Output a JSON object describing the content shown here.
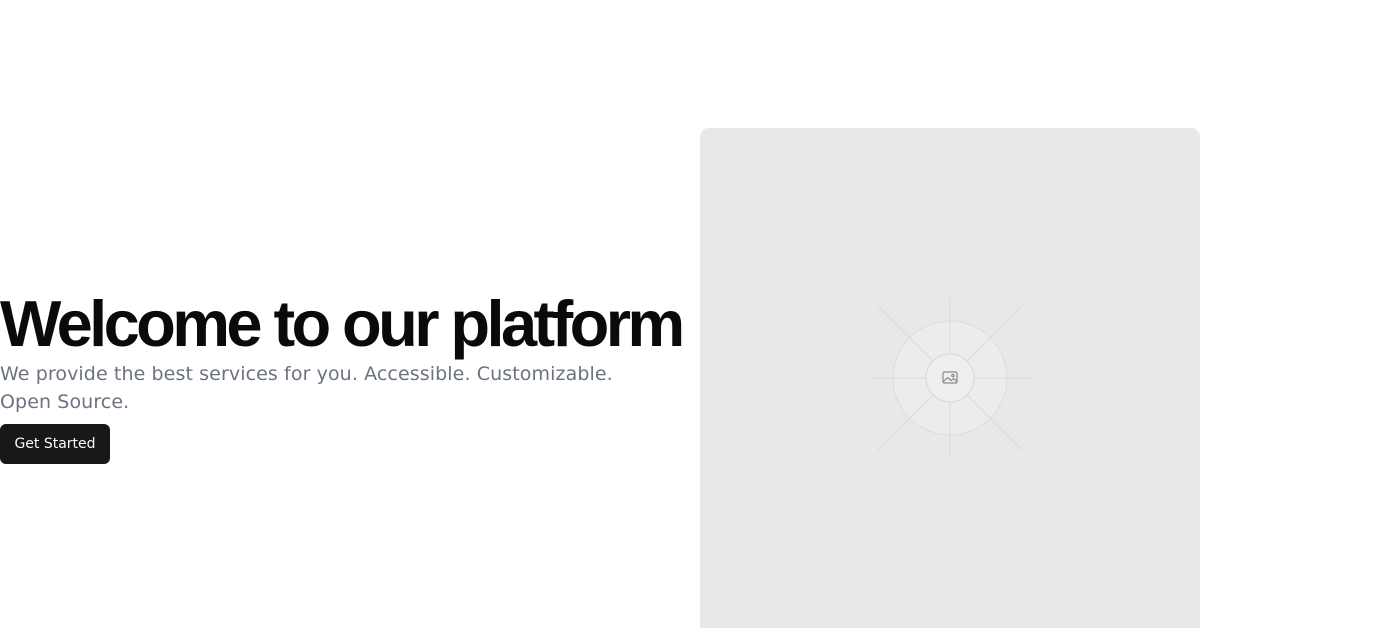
{
  "hero": {
    "title": "Welcome to our platform",
    "subtitle": "We provide the best services for you. Accessible. Customizable. Open Source.",
    "cta_label": "Get Started"
  },
  "media": {
    "icon": "image-icon",
    "placeholder_color": "#e8e8e8"
  },
  "colors": {
    "title": "#0a0a0a",
    "subtitle": "#6b7280",
    "button_bg": "#18181b",
    "button_text": "#fafafa"
  }
}
